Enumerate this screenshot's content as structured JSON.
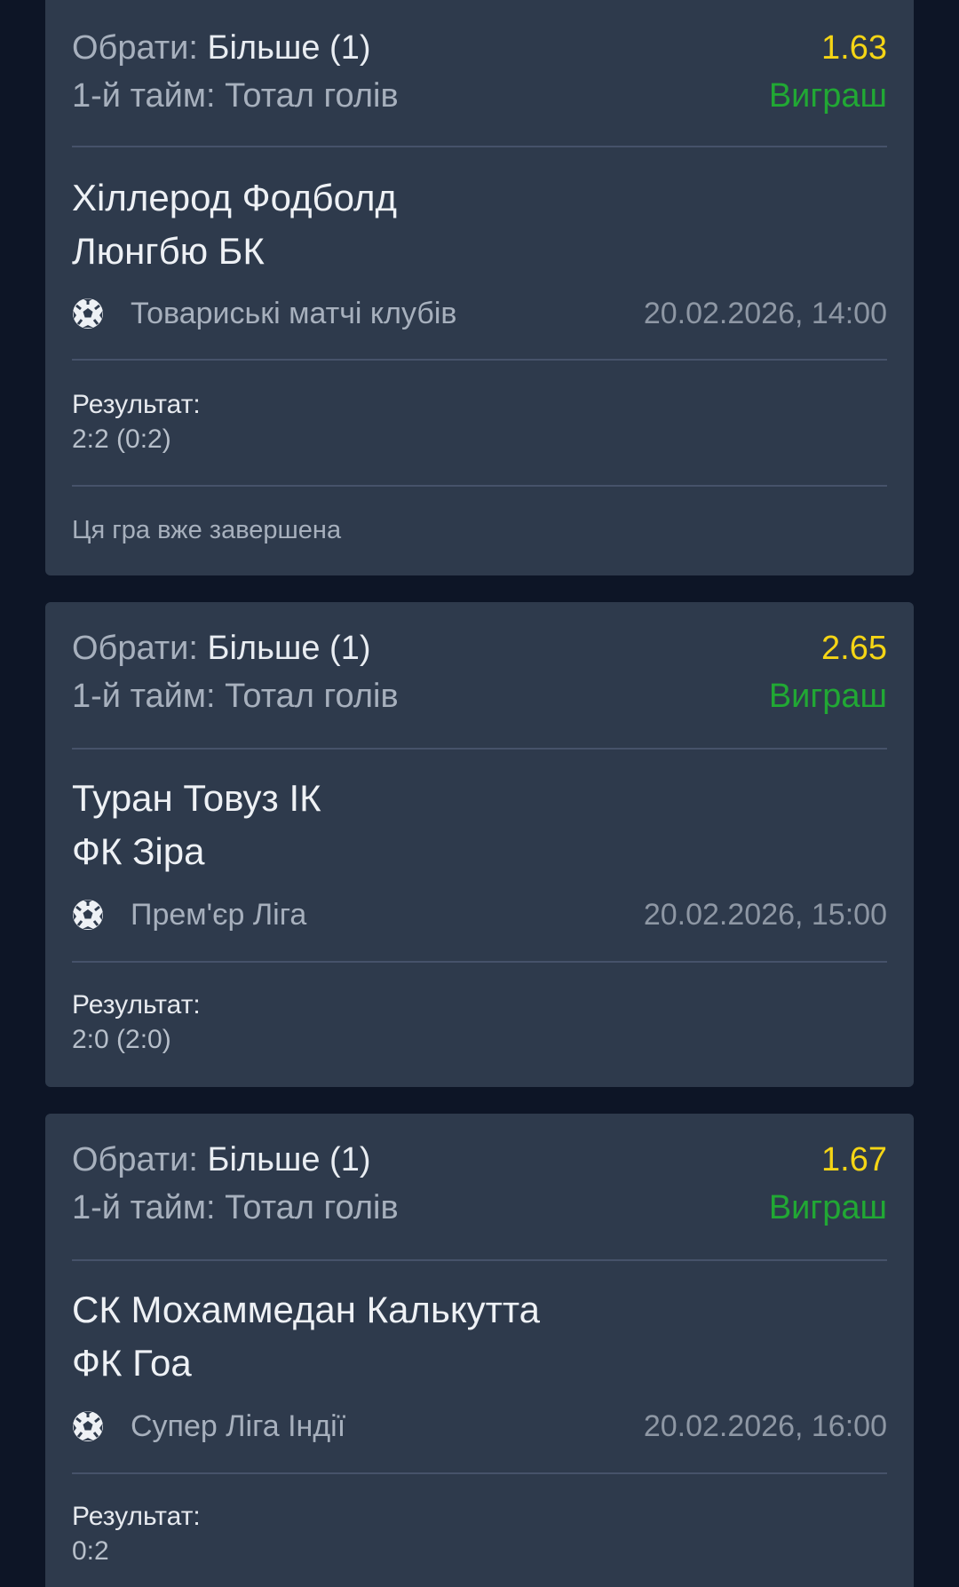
{
  "colors": {
    "background": "#0d1526",
    "card": "#2e3a4c",
    "accent": "#e3127a",
    "odds": "#f5d515",
    "win": "#21a834",
    "text_primary": "#eef1f5",
    "text_secondary": "#a7b0bd"
  },
  "bets": [
    {
      "pick_label": "Обрати:",
      "pick_value": "Більше (1)",
      "odds": "1.63",
      "market": "1-й тайм: Тотал голів",
      "status": "Виграш",
      "team_home": "Хіллерод Фодболд",
      "team_away": "Люнгбю БК",
      "sport_icon": "soccer-ball-icon",
      "league": "Товариські матчі клубів",
      "date": "20.02.2026, 14:00",
      "result_label": "Результат:",
      "result_value": "2:2 (0:2)",
      "note": "Ця гра вже завершена"
    },
    {
      "pick_label": "Обрати:",
      "pick_value": "Більше (1)",
      "odds": "2.65",
      "market": "1-й тайм: Тотал голів",
      "status": "Виграш",
      "team_home": "Туран Товуз ІК",
      "team_away": "ФК Зіра",
      "sport_icon": "soccer-ball-icon",
      "league": "Прем'єр Ліга",
      "date": "20.02.2026, 15:00",
      "result_label": "Результат:",
      "result_value": "2:0 (2:0)"
    },
    {
      "pick_label": "Обрати:",
      "pick_value": "Більше (1)",
      "odds": "1.67",
      "market": "1-й тайм: Тотал голів",
      "status": "Виграш",
      "team_home": "СК Мохаммедан Калькутта",
      "team_away": "ФК Гоа",
      "sport_icon": "soccer-ball-icon",
      "league": "Супер Ліга Індії",
      "date": "20.02.2026, 16:00",
      "result_label": "Результат:",
      "result_value": "0:2"
    }
  ]
}
